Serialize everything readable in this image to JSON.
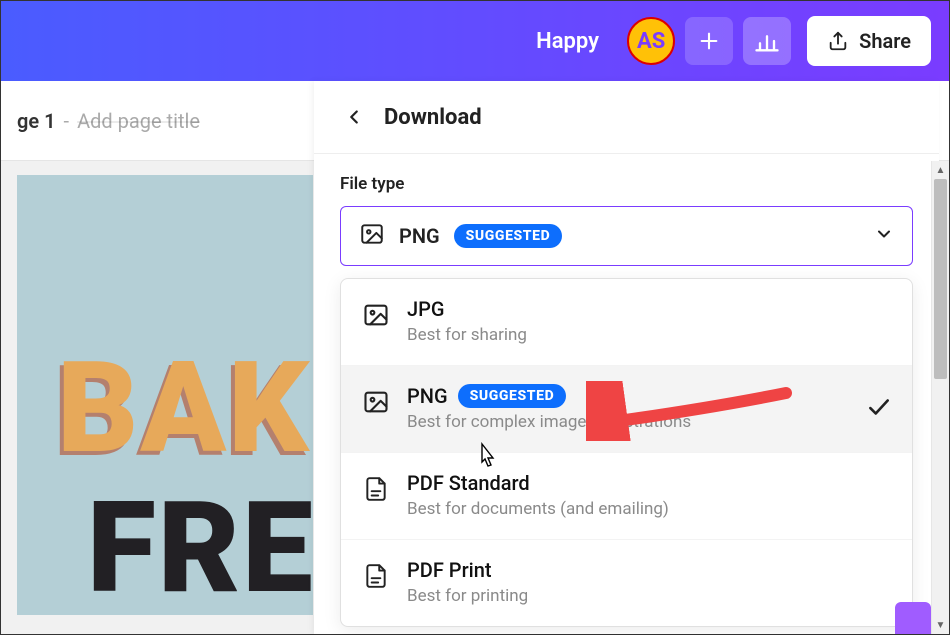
{
  "header": {
    "project_title": "Happy",
    "avatar_initials": "AS",
    "share_label": "Share"
  },
  "secondary": {
    "page_indicator": "ge 1",
    "page_placeholder": "Add page title"
  },
  "canvas": {
    "text_top": "BAK",
    "text_bottom": "FRE"
  },
  "download_panel": {
    "title": "Download",
    "file_type_label": "File type",
    "selected": {
      "name": "PNG",
      "badge": "SUGGESTED"
    },
    "options": [
      {
        "name": "JPG",
        "desc": "Best for sharing",
        "icon": "image",
        "selected": false,
        "badge": null
      },
      {
        "name": "PNG",
        "desc": "Best for complex images, illustrations",
        "icon": "image",
        "selected": true,
        "badge": "SUGGESTED"
      },
      {
        "name": "PDF Standard",
        "desc": "Best for documents (and emailing)",
        "icon": "pdf",
        "selected": false,
        "badge": null
      },
      {
        "name": "PDF Print",
        "desc": "Best for printing",
        "icon": "pdf",
        "selected": false,
        "badge": null
      }
    ]
  }
}
